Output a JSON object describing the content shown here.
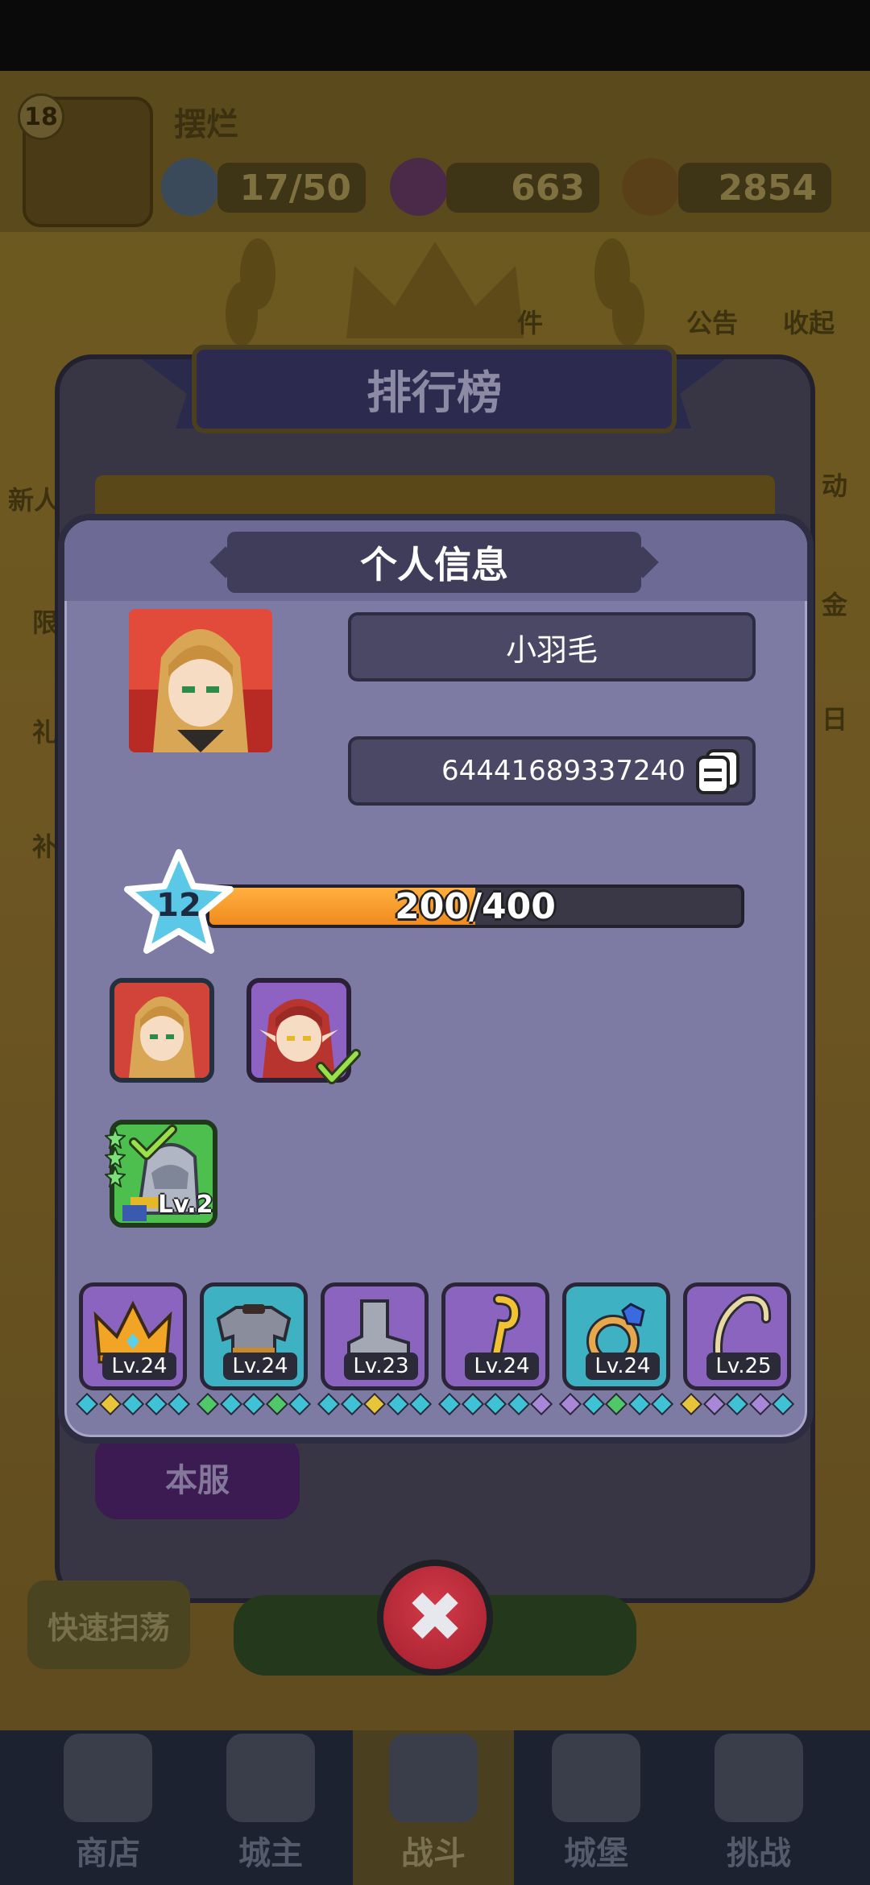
{
  "background": {
    "player": {
      "level": "18",
      "name": "摆烂"
    },
    "resources": {
      "stamina": "17/50",
      "gems": "663",
      "gold": "2854"
    },
    "side_labels": [
      "件",
      "公告",
      "收起",
      "新人",
      "动",
      "限",
      "金",
      "礼",
      "日",
      "补"
    ],
    "ranking": {
      "title": "排行榜",
      "server_tab": "本服"
    },
    "quick_sweep": "快速扫荡",
    "bottom_nav": [
      {
        "label": "商店",
        "icon": "shop-icon"
      },
      {
        "label": "城主",
        "icon": "crown-icon"
      },
      {
        "label": "战斗",
        "icon": "swords-icon"
      },
      {
        "label": "城堡",
        "icon": "castle-icon"
      },
      {
        "label": "挑战",
        "icon": "challenge-icon"
      }
    ]
  },
  "profile": {
    "title": "个人信息",
    "name": "小羽毛",
    "player_id": "64441689337240",
    "level": "12",
    "exp_text": "200/400",
    "exp_fraction": 0.5,
    "heroes": [
      {
        "icon": "blonde-hero-portrait",
        "selected": false
      },
      {
        "icon": "red-hair-elf-portrait",
        "selected": true
      }
    ],
    "pet": {
      "icon": "armored-mount-icon",
      "level": "Lv.2",
      "stars": 3,
      "selected": true
    },
    "equipment": [
      {
        "icon": "crown-icon",
        "level": "Lv.24",
        "rarity": "purple",
        "gems": [
          "#3fc2d6",
          "#e7c43a",
          "#3fc2d6",
          "#3fc2d6",
          "#3fc2d6"
        ]
      },
      {
        "icon": "chest-armor-icon",
        "level": "Lv.24",
        "rarity": "teal",
        "gems": [
          "#50c86a",
          "#3fc2d6",
          "#3fc2d6",
          "#50c86a",
          "#3fc2d6"
        ]
      },
      {
        "icon": "boot-icon",
        "level": "Lv.23",
        "rarity": "purple",
        "gems": [
          "#3fc2d6",
          "#3fc2d6",
          "#e7c43a",
          "#3fc2d6",
          "#3fc2d6"
        ]
      },
      {
        "icon": "staff-icon",
        "level": "Lv.24",
        "rarity": "purple",
        "gems": [
          "#3fc2d6",
          "#3fc2d6",
          "#3fc2d6",
          "#3fc2d6",
          "#a887d8"
        ]
      },
      {
        "icon": "ring-icon",
        "level": "Lv.24",
        "rarity": "teal",
        "gems": [
          "#a887d8",
          "#3fc2d6",
          "#50c86a",
          "#3fc2d6",
          "#3fc2d6"
        ]
      },
      {
        "icon": "bow-icon",
        "level": "Lv.25",
        "rarity": "purple",
        "gems": [
          "#e7c43a",
          "#a887d8",
          "#3fc2d6",
          "#a887d8",
          "#3fc2d6"
        ]
      }
    ]
  }
}
